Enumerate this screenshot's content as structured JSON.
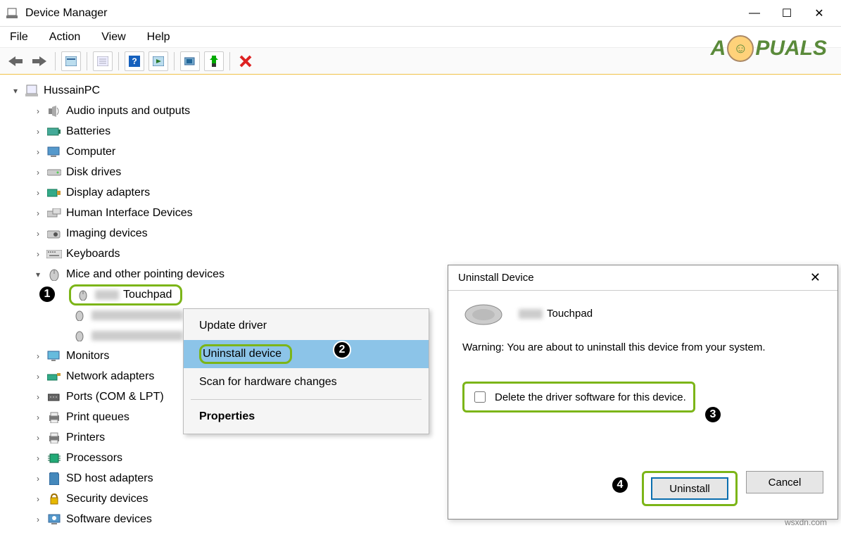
{
  "window": {
    "title": "Device Manager",
    "controls": {
      "minimize": "—",
      "maximize": "☐",
      "close": "✕"
    }
  },
  "menu": {
    "items": [
      "File",
      "Action",
      "View",
      "Help"
    ]
  },
  "tree": {
    "root": "HussainPC",
    "nodes": [
      {
        "label": "Audio inputs and outputs",
        "icon": "speaker"
      },
      {
        "label": "Batteries",
        "icon": "battery"
      },
      {
        "label": "Computer",
        "icon": "computer"
      },
      {
        "label": "Disk drives",
        "icon": "disk"
      },
      {
        "label": "Display adapters",
        "icon": "display"
      },
      {
        "label": "Human Interface Devices",
        "icon": "hid"
      },
      {
        "label": "Imaging devices",
        "icon": "imaging"
      },
      {
        "label": "Keyboards",
        "icon": "keyboard"
      },
      {
        "label": "Mice and other pointing devices",
        "icon": "mouse",
        "expanded": true,
        "children": [
          {
            "label": "Touchpad",
            "blurred_prefix": true,
            "highlighted": true,
            "annotation": "1"
          },
          {
            "label": "",
            "blurred_line": true
          },
          {
            "label": "",
            "blurred_line": true
          }
        ]
      },
      {
        "label": "Monitors",
        "icon": "monitor"
      },
      {
        "label": "Network adapters",
        "icon": "network"
      },
      {
        "label": "Ports (COM & LPT)",
        "icon": "port"
      },
      {
        "label": "Print queues",
        "icon": "printer"
      },
      {
        "label": "Printers",
        "icon": "printer"
      },
      {
        "label": "Processors",
        "icon": "processor"
      },
      {
        "label": "SD host adapters",
        "icon": "sd"
      },
      {
        "label": "Security devices",
        "icon": "security"
      },
      {
        "label": "Software devices",
        "icon": "software"
      }
    ]
  },
  "context_menu": {
    "items": [
      {
        "label": "Update driver"
      },
      {
        "label": "Uninstall device",
        "selected": true,
        "highlighted": true,
        "annotation": "2"
      },
      {
        "label": "Scan for hardware changes"
      }
    ],
    "properties_label": "Properties"
  },
  "dialog": {
    "title": "Uninstall Device",
    "device_name": "Touchpad",
    "warning": "Warning: You are about to uninstall this device from your system.",
    "checkbox_label": "Delete the driver software for this device.",
    "checkbox_annotation": "3",
    "uninstall_label": "Uninstall",
    "uninstall_annotation": "4",
    "cancel_label": "Cancel"
  },
  "watermark": {
    "brand_prefix": "A",
    "brand_suffix": "PUALS",
    "byline": "wsxdn.com"
  }
}
